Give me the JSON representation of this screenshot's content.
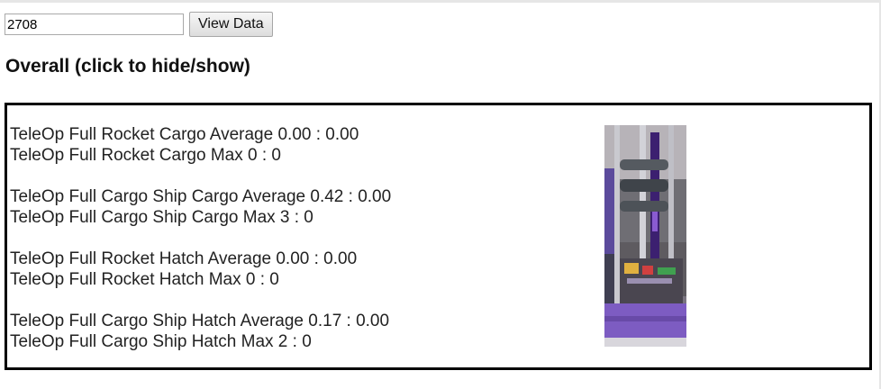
{
  "toolbar": {
    "team_value": "2708",
    "view_button_label": "View Data"
  },
  "overall": {
    "heading": "Overall (click to hide/show)",
    "groups": [
      {
        "average": "TeleOp Full Rocket Cargo Average 0.00 : 0.00",
        "max": "TeleOp Full Rocket Cargo Max 0 : 0"
      },
      {
        "average": "TeleOp Full Cargo Ship Cargo Average 0.42 : 0.00",
        "max": "TeleOp Full Cargo Ship Cargo Max 3 : 0"
      },
      {
        "average": "TeleOp Full Rocket Hatch Average 0.00 : 0.00",
        "max": "TeleOp Full Rocket Hatch Max 0 : 0"
      },
      {
        "average": "TeleOp Full Cargo Ship Hatch Average 0.17 : 0.00",
        "max": "TeleOp Full Cargo Ship Hatch Max 2 : 0"
      }
    ],
    "photo_icon": "robot-photo-icon"
  }
}
